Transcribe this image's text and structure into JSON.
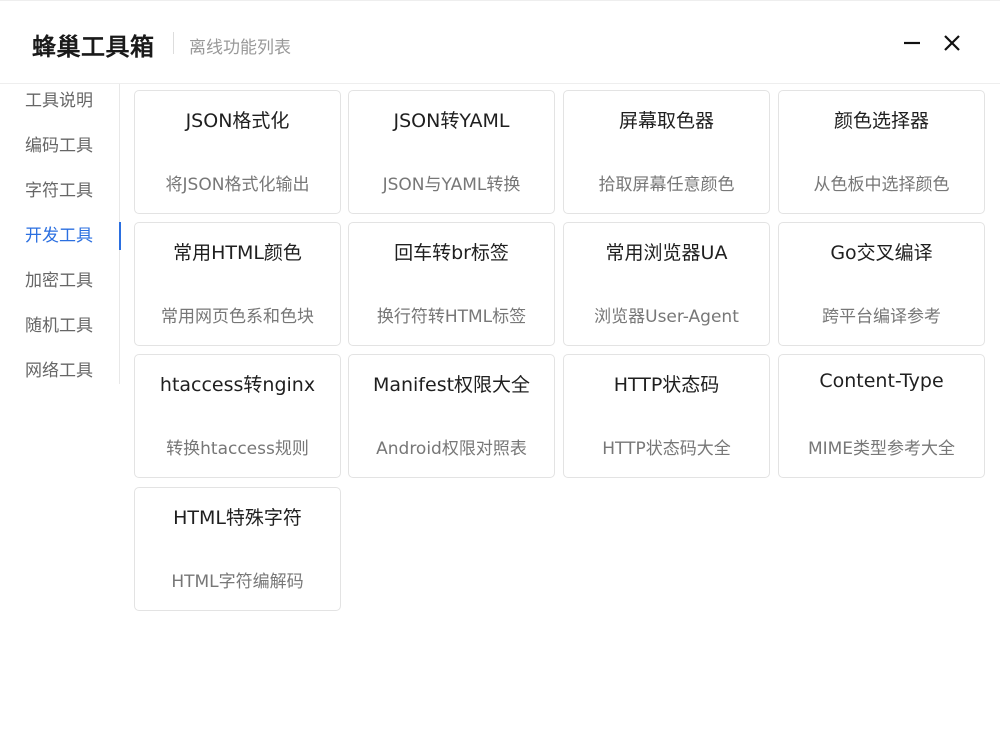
{
  "header": {
    "title": "蜂巢工具箱",
    "subtitle": "离线功能列表",
    "minimize_icon": "minimize-icon",
    "close_icon": "close-icon"
  },
  "sidebar": {
    "items": [
      {
        "label": "工具说明",
        "active": false
      },
      {
        "label": "编码工具",
        "active": false
      },
      {
        "label": "字符工具",
        "active": false
      },
      {
        "label": "开发工具",
        "active": true
      },
      {
        "label": "加密工具",
        "active": false
      },
      {
        "label": "随机工具",
        "active": false
      },
      {
        "label": "网络工具",
        "active": false
      }
    ],
    "active_color": "#2b6fe0"
  },
  "tools": [
    {
      "title": "JSON格式化",
      "desc": "将JSON格式化输出"
    },
    {
      "title": "JSON转YAML",
      "desc": "JSON与YAML转换"
    },
    {
      "title": "屏幕取色器",
      "desc": "拾取屏幕任意颜色"
    },
    {
      "title": "颜色选择器",
      "desc": "从色板中选择颜色"
    },
    {
      "title": "常用HTML颜色",
      "desc": "常用网页色系和色块"
    },
    {
      "title": "回车转br标签",
      "desc": "换行符转HTML标签"
    },
    {
      "title": "常用浏览器UA",
      "desc": "浏览器User-Agent"
    },
    {
      "title": "Go交叉编译",
      "desc": "跨平台编译参考"
    },
    {
      "title": "htaccess转nginx",
      "desc": "转换htaccess规则"
    },
    {
      "title": "Manifest权限大全",
      "desc": "Android权限对照表"
    },
    {
      "title": "HTTP状态码",
      "desc": "HTTP状态码大全"
    },
    {
      "title": "Content-Type",
      "desc": "MIME类型参考大全"
    },
    {
      "title": "HTML特殊字符",
      "desc": "HTML字符编解码"
    }
  ]
}
